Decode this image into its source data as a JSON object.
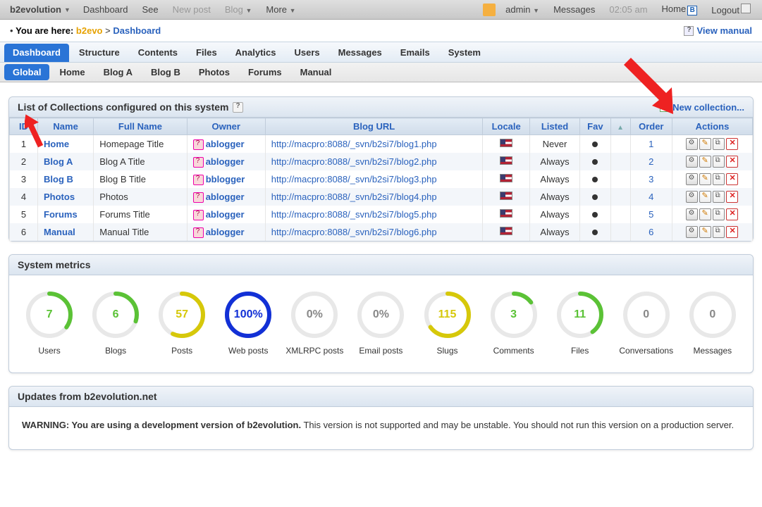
{
  "topbar": {
    "brand": "b2evolution",
    "items_left": [
      "Dashboard",
      "See"
    ],
    "items_disabled": [
      "New post",
      "Blog"
    ],
    "more": "More",
    "admin": "admin",
    "messages": "Messages",
    "time": "02:05 am",
    "home": "Home",
    "logout": "Logout"
  },
  "breadcrumb": {
    "prefix": "You are here:",
    "b2evo": "b2evo",
    "sep": ">",
    "current": "Dashboard",
    "view_manual": "View manual"
  },
  "tabs": {
    "main": [
      "Dashboard",
      "Structure",
      "Contents",
      "Files",
      "Analytics",
      "Users",
      "Messages",
      "Emails",
      "System"
    ],
    "main_active": 0,
    "sub": [
      "Global",
      "Home",
      "Blog A",
      "Blog B",
      "Photos",
      "Forums",
      "Manual"
    ],
    "sub_active": 0
  },
  "collections_panel": {
    "title": "List of Collections configured on this system",
    "new_link": "New collection...",
    "columns": [
      "ID",
      "Name",
      "Full Name",
      "Owner",
      "Blog URL",
      "Locale",
      "Listed",
      "Fav",
      "",
      "Order",
      "Actions"
    ],
    "rows": [
      {
        "id": "1",
        "name": "Home",
        "full": "Homepage Title",
        "owner": "ablogger",
        "url": "http://macpro:8088/_svn/b2si7/blog1.php",
        "listed": "Never",
        "order": "1"
      },
      {
        "id": "2",
        "name": "Blog A",
        "full": "Blog A Title",
        "owner": "ablogger",
        "url": "http://macpro:8088/_svn/b2si7/blog2.php",
        "listed": "Always",
        "order": "2"
      },
      {
        "id": "3",
        "name": "Blog B",
        "full": "Blog B Title",
        "owner": "bblogger",
        "url": "http://macpro:8088/_svn/b2si7/blog3.php",
        "listed": "Always",
        "order": "3"
      },
      {
        "id": "4",
        "name": "Photos",
        "full": "Photos",
        "owner": "ablogger",
        "url": "http://macpro:8088/_svn/b2si7/blog4.php",
        "listed": "Always",
        "order": "4"
      },
      {
        "id": "5",
        "name": "Forums",
        "full": "Forums Title",
        "owner": "ablogger",
        "url": "http://macpro:8088/_svn/b2si7/blog5.php",
        "listed": "Always",
        "order": "5"
      },
      {
        "id": "6",
        "name": "Manual",
        "full": "Manual Title",
        "owner": "ablogger",
        "url": "http://macpro:8088/_svn/b2si7/blog6.php",
        "listed": "Always",
        "order": "6"
      }
    ]
  },
  "metrics_panel": {
    "title": "System metrics",
    "items": [
      {
        "value": "7",
        "label": "Users",
        "pct": 35,
        "color": "#5bc236"
      },
      {
        "value": "6",
        "label": "Blogs",
        "pct": 30,
        "color": "#5bc236"
      },
      {
        "value": "57",
        "label": "Posts",
        "pct": 57,
        "color": "#d6c80a"
      },
      {
        "value": "100%",
        "label": "Web posts",
        "pct": 100,
        "color": "#1230d6"
      },
      {
        "value": "0%",
        "label": "XMLRPC posts",
        "pct": 0,
        "color": "#888"
      },
      {
        "value": "0%",
        "label": "Email posts",
        "pct": 0,
        "color": "#888"
      },
      {
        "value": "115",
        "label": "Slugs",
        "pct": 65,
        "color": "#d6c80a"
      },
      {
        "value": "3",
        "label": "Comments",
        "pct": 15,
        "color": "#5bc236"
      },
      {
        "value": "11",
        "label": "Files",
        "pct": 40,
        "color": "#5bc236"
      },
      {
        "value": "0",
        "label": "Conversations",
        "pct": 0,
        "color": "#888"
      },
      {
        "value": "0",
        "label": "Messages",
        "pct": 0,
        "color": "#888"
      }
    ]
  },
  "updates_panel": {
    "title": "Updates from b2evolution.net",
    "warning_bold": "WARNING: You are using a development version of b2evolution.",
    "warning_rest": " This version is not supported and may be unstable. You should not run this version on a production server."
  }
}
